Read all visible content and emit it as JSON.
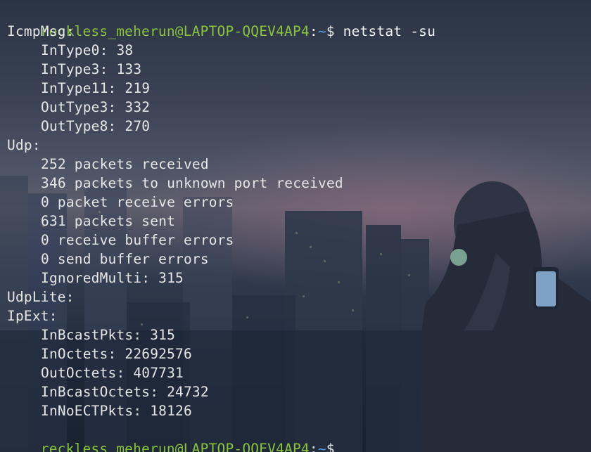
{
  "terminal": {
    "prompt": {
      "user_host": "reckless_meherun@LAPTOP-QQEV4AP4",
      "separator": ":",
      "path": "~",
      "symbol": "$"
    },
    "command": "netstat -su",
    "output": [
      {
        "text": "IcmpMsg:",
        "indent": false
      },
      {
        "text": "InType0: 38",
        "indent": true
      },
      {
        "text": "InType3: 133",
        "indent": true
      },
      {
        "text": "InType11: 219",
        "indent": true
      },
      {
        "text": "OutType3: 332",
        "indent": true
      },
      {
        "text": "OutType8: 270",
        "indent": true
      },
      {
        "text": "Udp:",
        "indent": false
      },
      {
        "text": "252 packets received",
        "indent": true
      },
      {
        "text": "346 packets to unknown port received",
        "indent": true
      },
      {
        "text": "0 packet receive errors",
        "indent": true
      },
      {
        "text": "631 packets sent",
        "indent": true
      },
      {
        "text": "0 receive buffer errors",
        "indent": true
      },
      {
        "text": "0 send buffer errors",
        "indent": true
      },
      {
        "text": "IgnoredMulti: 315",
        "indent": true
      },
      {
        "text": "UdpLite:",
        "indent": false
      },
      {
        "text": "IpExt:",
        "indent": false
      },
      {
        "text": "InBcastPkts: 315",
        "indent": true
      },
      {
        "text": "InOctets: 22692576",
        "indent": true
      },
      {
        "text": "OutOctets: 407731",
        "indent": true
      },
      {
        "text": "InBcastOctets: 24732",
        "indent": true
      },
      {
        "text": "InNoECTPkts: 18126",
        "indent": true
      }
    ]
  },
  "colors": {
    "user_host": "#8ac33d",
    "path": "#5c9ee8",
    "text": "#e6e6e6"
  }
}
